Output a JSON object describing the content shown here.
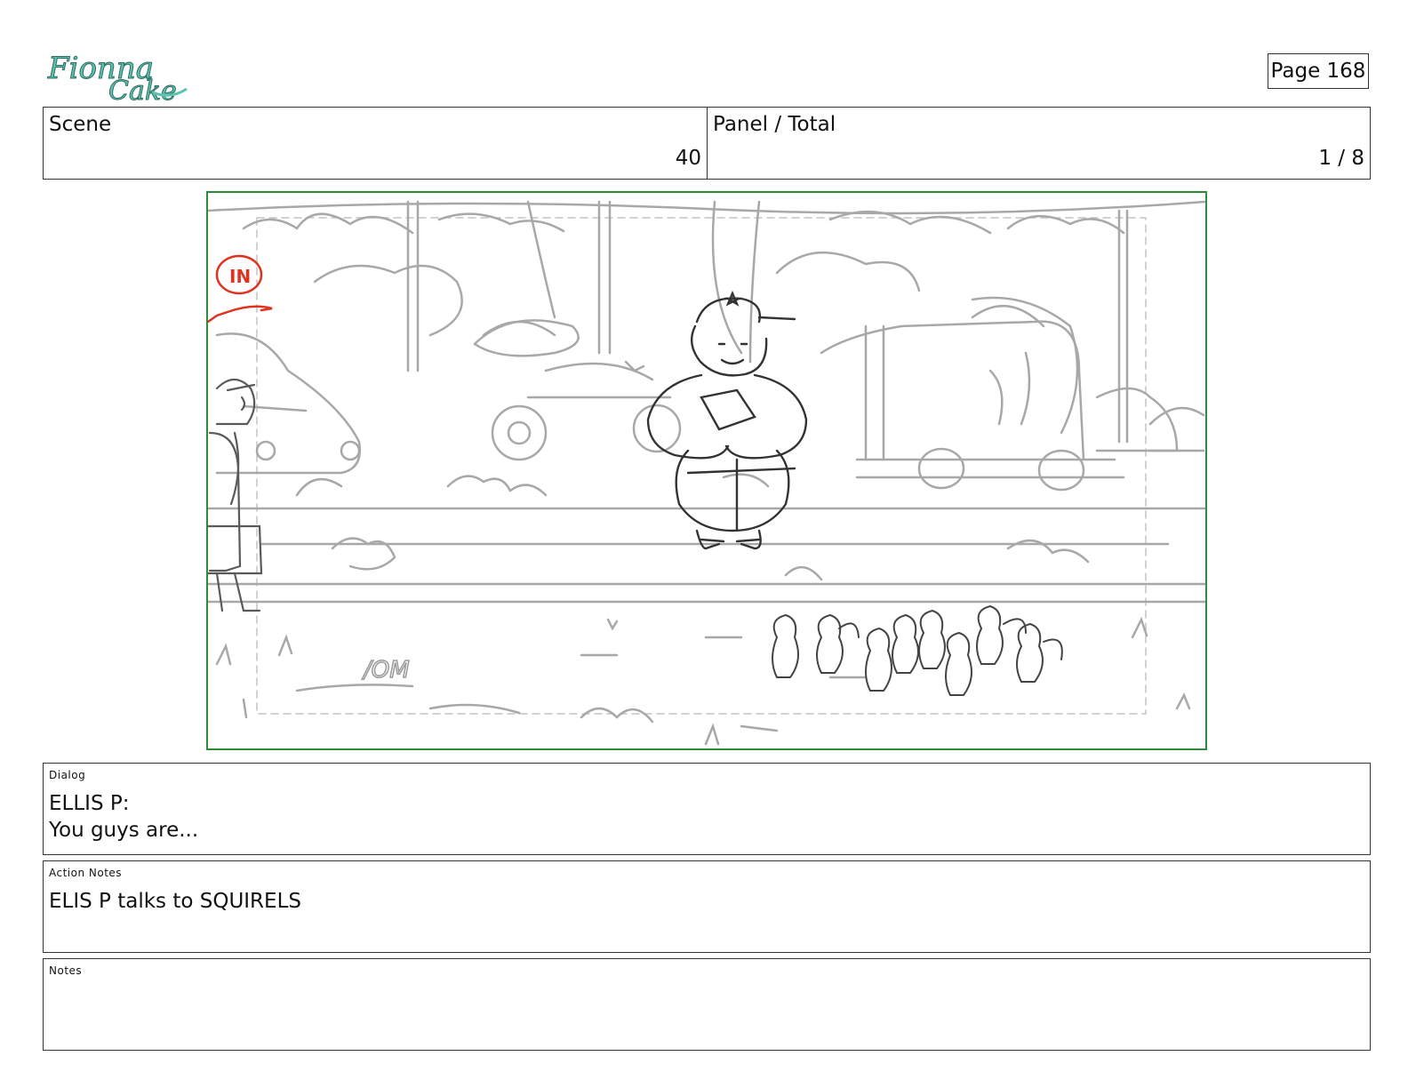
{
  "logo": {
    "text": "Fionna and Cake"
  },
  "page": {
    "label": "Page 168"
  },
  "header": {
    "scene_label": "Scene",
    "scene_value": "40",
    "panel_label": "Panel / Total",
    "panel_value": "1 / 8"
  },
  "frame": {
    "annotation": "IN",
    "sign_text": "/OM"
  },
  "dialog": {
    "label": "Dialog",
    "text": "ELLIS P:\nYou guys are..."
  },
  "action_notes": {
    "label": "Action Notes",
    "text": "ELIS P talks to SQUIRELS"
  },
  "notes": {
    "label": "Notes",
    "text": ""
  },
  "colors": {
    "frame_border": "#2f8a3a",
    "annotation": "#e0321e",
    "logo": "#5cc3b0"
  }
}
